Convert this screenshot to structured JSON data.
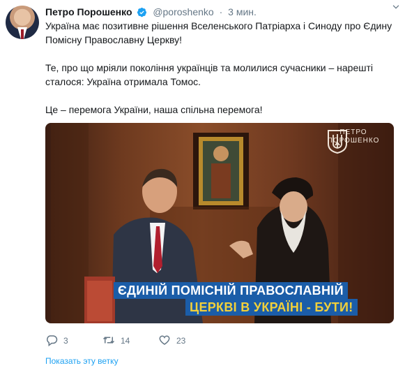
{
  "tweet": {
    "display_name": "Петро Порошенко",
    "handle": "@poroshenko",
    "separator": "·",
    "time": "3 мин.",
    "paragraphs": [
      "Україна має позитивне рішення Вселенського Патріарха і Синоду про Єдину Помісну Православну Церкву!",
      "Те, про що мріяли покоління українців та молилися сучасники – нарешті сталося: Україна отримала Томос.",
      "Це – перемога України, наша спільна перемога!"
    ]
  },
  "media": {
    "banner_line_1": "ЄДИНІЙ ПОМІСНІЙ ПРАВОСЛАВНІЙ",
    "banner_line_2": "ЦЕРКВІ В УКРАЇНІ - БУТИ!",
    "brand_line_1": "ПЕТРО",
    "brand_line_2": "ПОРОШЕНКО"
  },
  "actions": {
    "replies": "3",
    "retweets": "14",
    "likes": "23"
  },
  "show_thread": "Показать эту ветку",
  "colors": {
    "text": "#14171a",
    "muted": "#657786",
    "link": "#1da1f2",
    "verified": "#1da1f2",
    "banner_bg": "#1b5da8",
    "banner_highlight": "#f2d03a"
  },
  "icons": {
    "verified": "verified-badge-icon",
    "caret": "chevron-down-icon",
    "reply": "reply-icon",
    "retweet": "retweet-icon",
    "like": "heart-icon",
    "crest": "trident-icon"
  }
}
